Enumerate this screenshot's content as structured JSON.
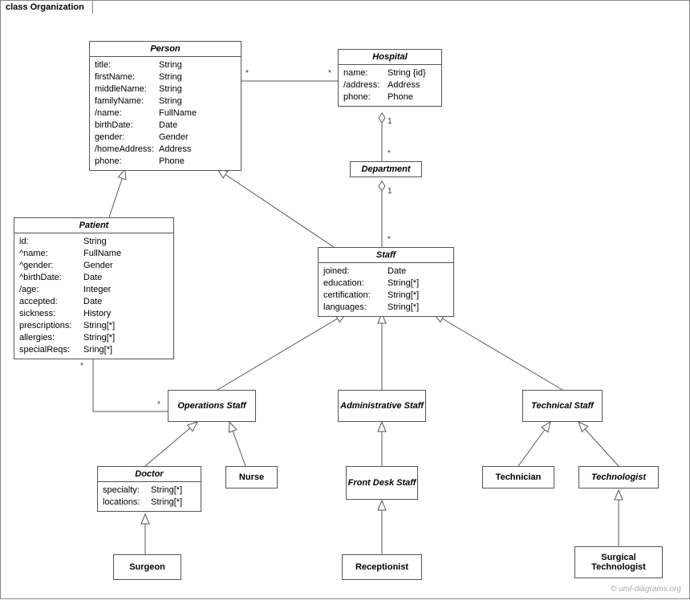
{
  "diagram_title": "class Organization",
  "watermark": "© uml-diagrams.org",
  "classes": {
    "person": {
      "name": "Person",
      "attrs": [
        {
          "k": "title:",
          "v": "String"
        },
        {
          "k": "firstName:",
          "v": "String"
        },
        {
          "k": "middleName:",
          "v": "String"
        },
        {
          "k": "familyName:",
          "v": "String"
        },
        {
          "k": "/name:",
          "v": "FullName"
        },
        {
          "k": "birthDate:",
          "v": "Date"
        },
        {
          "k": "gender:",
          "v": "Gender"
        },
        {
          "k": "/homeAddress:",
          "v": "Address"
        },
        {
          "k": "phone:",
          "v": "Phone"
        }
      ]
    },
    "hospital": {
      "name": "Hospital",
      "attrs": [
        {
          "k": "name:",
          "v": "String {id}"
        },
        {
          "k": "/address:",
          "v": "Address"
        },
        {
          "k": "phone:",
          "v": "Phone"
        }
      ]
    },
    "patient": {
      "name": "Patient",
      "attrs": [
        {
          "k": "id:",
          "v": "String"
        },
        {
          "k": "^name:",
          "v": "FullName"
        },
        {
          "k": "^gender:",
          "v": "Gender"
        },
        {
          "k": "^birthDate:",
          "v": "Date"
        },
        {
          "k": "/age:",
          "v": "Integer"
        },
        {
          "k": "accepted:",
          "v": "Date"
        },
        {
          "k": "sickness:",
          "v": "History"
        },
        {
          "k": "prescriptions:",
          "v": "String[*]"
        },
        {
          "k": "allergies:",
          "v": "String[*]"
        },
        {
          "k": "specialReqs:",
          "v": "Sring[*]"
        }
      ]
    },
    "department": {
      "name": "Department"
    },
    "staff": {
      "name": "Staff",
      "attrs": [
        {
          "k": "joined:",
          "v": "Date"
        },
        {
          "k": "education:",
          "v": "String[*]"
        },
        {
          "k": "certification:",
          "v": "String[*]"
        },
        {
          "k": "languages:",
          "v": "String[*]"
        }
      ]
    },
    "opstaff": {
      "name": "Operations Staff"
    },
    "adminstaff": {
      "name": "Administrative Staff"
    },
    "techstaff": {
      "name": "Technical Staff"
    },
    "doctor": {
      "name": "Doctor",
      "attrs": [
        {
          "k": "specialty:",
          "v": "String[*]"
        },
        {
          "k": "locations:",
          "v": "String[*]"
        }
      ]
    },
    "nurse": {
      "name": "Nurse"
    },
    "frontdesk": {
      "name": "Front Desk Staff"
    },
    "receptionist": {
      "name": "Receptionist"
    },
    "technician": {
      "name": "Technician"
    },
    "technologist": {
      "name": "Technologist"
    },
    "surgtech": {
      "name": "Surgical Technologist"
    },
    "surgeon": {
      "name": "Surgeon"
    }
  },
  "multiplicities": {
    "person_hospital_l": "*",
    "person_hospital_r": "*",
    "hospital_dept_top": "1",
    "hospital_dept_bot": "*",
    "dept_staff_top": "1",
    "dept_staff_bot": "*",
    "patient_opstaff_l": "*",
    "patient_opstaff_r": "*"
  }
}
